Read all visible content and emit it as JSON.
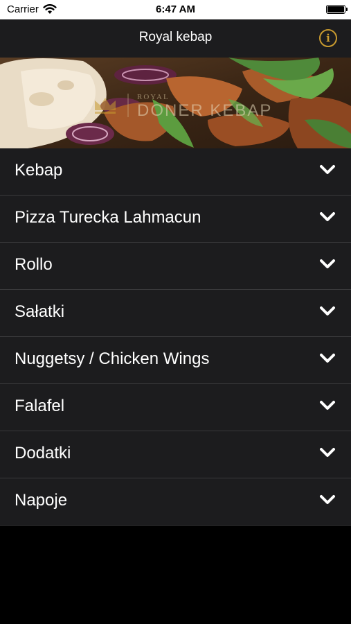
{
  "status_bar": {
    "carrier": "Carrier",
    "time": "6:47 AM"
  },
  "nav": {
    "title": "Royal kebap",
    "info_icon": "info-icon",
    "accent_color": "#c89a2f"
  },
  "banner": {
    "logo_small": "ROYAL",
    "logo_big": "DONER KEBAP"
  },
  "menu": {
    "items": [
      {
        "label": "Kebap"
      },
      {
        "label": "Pizza Turecka Lahmacun"
      },
      {
        "label": "Rollo"
      },
      {
        "label": "Sałatki"
      },
      {
        "label": "Nuggetsy / Chicken Wings"
      },
      {
        "label": "Falafel"
      },
      {
        "label": "Dodatki"
      },
      {
        "label": "Napoje"
      }
    ],
    "expand_icon": "chevron-down-icon"
  },
  "colors": {
    "background": "#000000",
    "cell": "#1c1c1e",
    "separator": "#3a3a3c",
    "text": "#ffffff"
  }
}
